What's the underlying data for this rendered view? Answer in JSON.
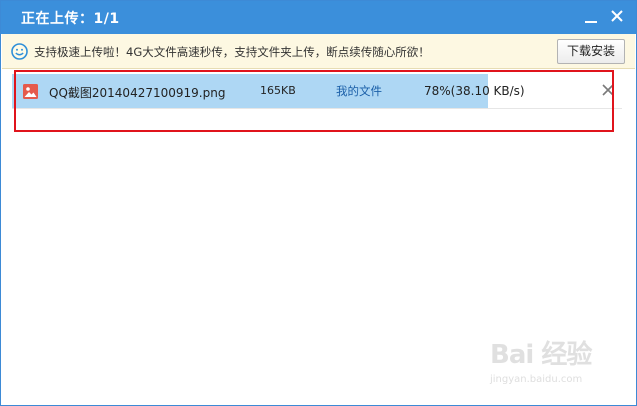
{
  "window": {
    "title": "正在上传：1/1",
    "accent_color": "#3b8fdb"
  },
  "notice": {
    "icon": "smile-icon",
    "text": "支持极速上传啦！4G大文件高速秒传，支持文件夹上传，断点续传随心所欲！",
    "button_label": "下载安装"
  },
  "uploads": [
    {
      "icon": "image-file-icon",
      "name": "QQ截图20140427100919.png",
      "size": "165KB",
      "destination": "我的文件",
      "progress_percent": 78,
      "status": "78%(38.10 KB/s)"
    }
  ],
  "watermark": {
    "main": "Bai 经验",
    "sub": "jingyan.baidu.com"
  }
}
